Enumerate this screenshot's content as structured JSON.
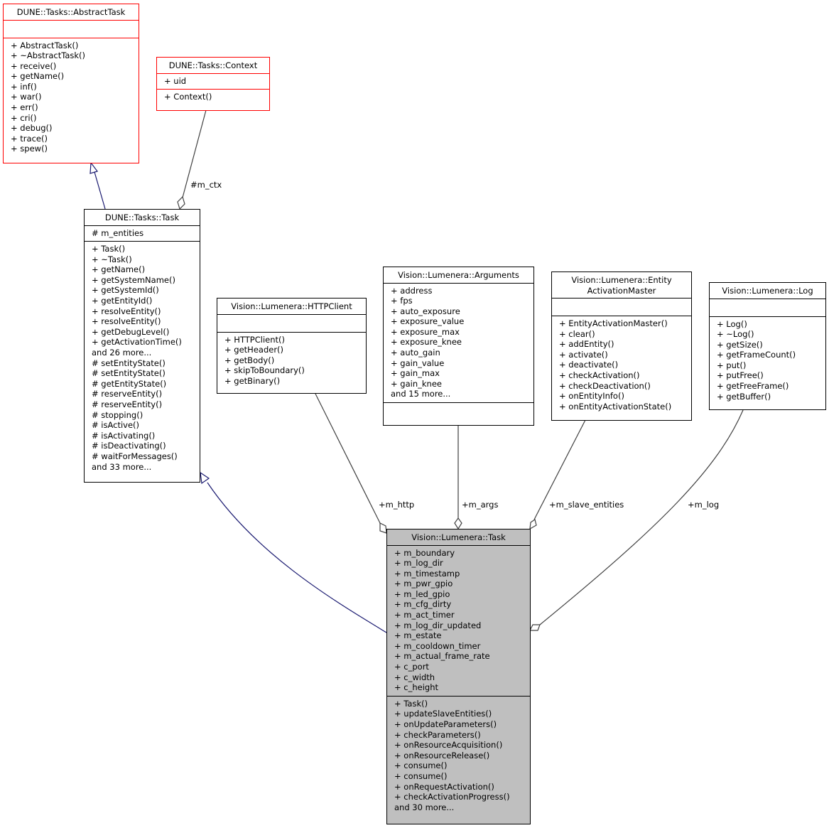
{
  "diagram": {
    "type": "uml-class-collaboration",
    "colors": {
      "external_border": "#ff0000",
      "focus_fill": "#bfbfbf",
      "inheritance_edge": "#191970",
      "association_edge": "#404040"
    },
    "classes": {
      "abstract_task": {
        "name": "DUNE::Tasks::AbstractTask",
        "attributes": [],
        "methods": [
          "+ AbstractTask()",
          "+ ~AbstractTask()",
          "+ receive()",
          "+ getName()",
          "+ inf()",
          "+ war()",
          "+ err()",
          "+ cri()",
          "+ debug()",
          "+ trace()",
          "+ spew()"
        ]
      },
      "context": {
        "name": "DUNE::Tasks::Context",
        "attributes": [
          "+ uid"
        ],
        "methods": [
          "+ Context()"
        ]
      },
      "dune_task": {
        "name": "DUNE::Tasks::Task",
        "attributes": [
          "# m_entities"
        ],
        "methods": [
          "+ Task()",
          "+ ~Task()",
          "+ getName()",
          "+ getSystemName()",
          "+ getSystemId()",
          "+ getEntityId()",
          "+ resolveEntity()",
          "+ resolveEntity()",
          "+ getDebugLevel()",
          "+ getActivationTime()",
          "and 26 more...",
          "# setEntityState()",
          "# setEntityState()",
          "# getEntityState()",
          "# reserveEntity()",
          "# reserveEntity()",
          "# stopping()",
          "# isActive()",
          "# isActivating()",
          "# isDeactivating()",
          "# waitForMessages()",
          "and 33 more..."
        ]
      },
      "http_client": {
        "name": "Vision::Lumenera::HTTPClient",
        "attributes": [],
        "methods": [
          "+ HTTPClient()",
          "+ getHeader()",
          "+ getBody()",
          "+ skipToBoundary()",
          "+ getBinary()"
        ]
      },
      "arguments": {
        "name": "Vision::Lumenera::Arguments",
        "attributes": [
          "+ address",
          "+ fps",
          "+ auto_exposure",
          "+ exposure_value",
          "+ exposure_max",
          "+ exposure_knee",
          "+ auto_gain",
          "+ gain_value",
          "+ gain_max",
          "+ gain_knee",
          "and 15 more..."
        ],
        "methods": []
      },
      "entity_activation_master": {
        "name_line1": "Vision::Lumenera::Entity",
        "name_line2": "ActivationMaster",
        "attributes": [],
        "methods": [
          "+ EntityActivationMaster()",
          "+ clear()",
          "+ addEntity()",
          "+ activate()",
          "+ deactivate()",
          "+ checkActivation()",
          "+ checkDeactivation()",
          "+ onEntityInfo()",
          "+ onEntityActivationState()"
        ]
      },
      "log": {
        "name": "Vision::Lumenera::Log",
        "attributes": [],
        "methods": [
          "+ Log()",
          "+ ~Log()",
          "+ getSize()",
          "+ getFrameCount()",
          "+ put()",
          "+ putFree()",
          "+ getFreeFrame()",
          "+ getBuffer()"
        ]
      },
      "lumenera_task": {
        "name": "Vision::Lumenera::Task",
        "attributes": [
          "+ m_boundary",
          "+ m_log_dir",
          "+ m_timestamp",
          "+ m_pwr_gpio",
          "+ m_led_gpio",
          "+ m_cfg_dirty",
          "+ m_act_timer",
          "+ m_log_dir_updated",
          "+ m_estate",
          "+ m_cooldown_timer",
          "+ m_actual_frame_rate",
          "+ c_port",
          "+ c_width",
          "+ c_height"
        ],
        "methods": [
          "+ Task()",
          "+ updateSlaveEntities()",
          "+ onUpdateParameters()",
          "+ checkParameters()",
          "+ onResourceAcquisition()",
          "+ onResourceRelease()",
          "+ consume()",
          "+ consume()",
          "+ onRequestActivation()",
          "+ checkActivationProgress()",
          "and 30 more..."
        ]
      }
    },
    "edges": [
      {
        "from": "dune_task",
        "to": "abstract_task",
        "kind": "inheritance",
        "label": ""
      },
      {
        "from": "lumenera_task",
        "to": "dune_task",
        "kind": "inheritance",
        "label": ""
      },
      {
        "from": "context",
        "to": "dune_task",
        "kind": "aggregation",
        "label": "#m_ctx"
      },
      {
        "from": "http_client",
        "to": "lumenera_task",
        "kind": "aggregation",
        "label": "+m_http"
      },
      {
        "from": "arguments",
        "to": "lumenera_task",
        "kind": "aggregation",
        "label": "+m_args"
      },
      {
        "from": "entity_activation_master",
        "to": "lumenera_task",
        "kind": "aggregation",
        "label": "+m_slave_entities"
      },
      {
        "from": "log",
        "to": "lumenera_task",
        "kind": "aggregation",
        "label": "+m_log"
      }
    ],
    "edge_labels": {
      "m_ctx": "#m_ctx",
      "m_http": "+m_http",
      "m_args": "+m_args",
      "m_slave_entities": "+m_slave_entities",
      "m_log": "+m_log"
    }
  }
}
